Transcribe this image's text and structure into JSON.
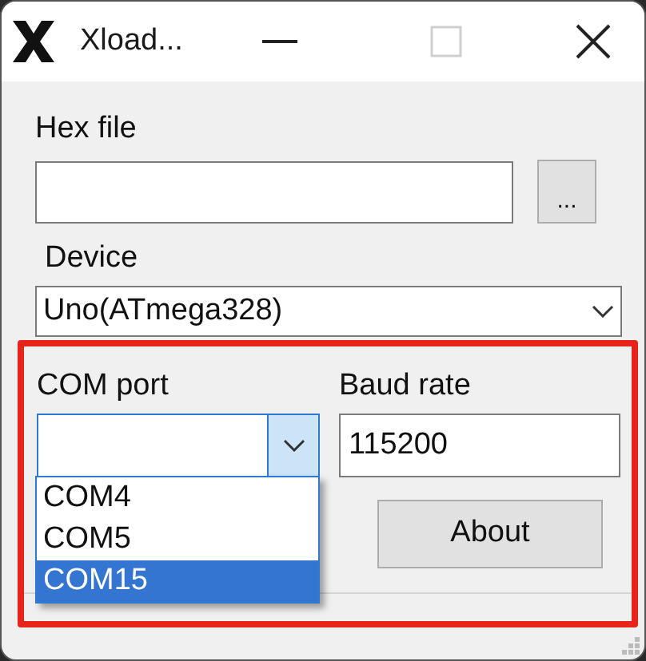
{
  "window": {
    "title": "Xload..."
  },
  "hex_file": {
    "label": "Hex file",
    "browse_button": "..."
  },
  "device": {
    "label": "Device",
    "value": "Uno(ATmega328)"
  },
  "com_port": {
    "label": "COM port",
    "expanded": true,
    "options": [
      {
        "label": "COM4",
        "selected": false
      },
      {
        "label": "COM5",
        "selected": false
      },
      {
        "label": "COM15",
        "selected": true
      }
    ]
  },
  "baud_rate": {
    "label": "Baud rate",
    "value": "115200"
  },
  "about_button": "About"
}
